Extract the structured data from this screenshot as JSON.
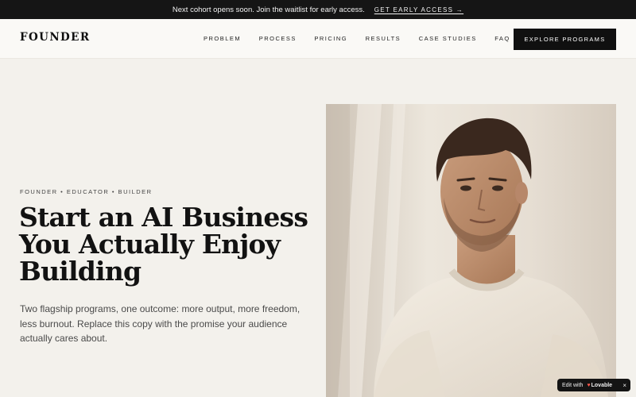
{
  "announcement": {
    "message": "Next cohort opens soon. Join the waitlist for early access.",
    "cta": "GET EARLY ACCESS →"
  },
  "nav": {
    "logo": "FOUNDER",
    "items": [
      "PROBLEM",
      "PROCESS",
      "PRICING",
      "RESULTS",
      "CASE STUDIES",
      "FAQ"
    ],
    "cta": "EXPLORE PROGRAMS"
  },
  "hero": {
    "eyebrow": "FOUNDER • EDUCATOR • BUILDER",
    "headline_lines": [
      "Start an AI Business",
      "You Actually Enjoy",
      "Building"
    ],
    "subtext": "Two flagship programs, one outcome: more output, more freedom, less burnout. Replace this copy with the promise your audience actually cares about."
  },
  "badge": {
    "prefix": "Edit with",
    "heart_icon": "heart-icon",
    "brand": "Lovable",
    "close": "×"
  },
  "colors": {
    "topbar": "#151515",
    "nav_bg": "#faf9f6",
    "page_bg": "#f3f1ec",
    "button": "#101010",
    "sweater": "#ede6da"
  }
}
